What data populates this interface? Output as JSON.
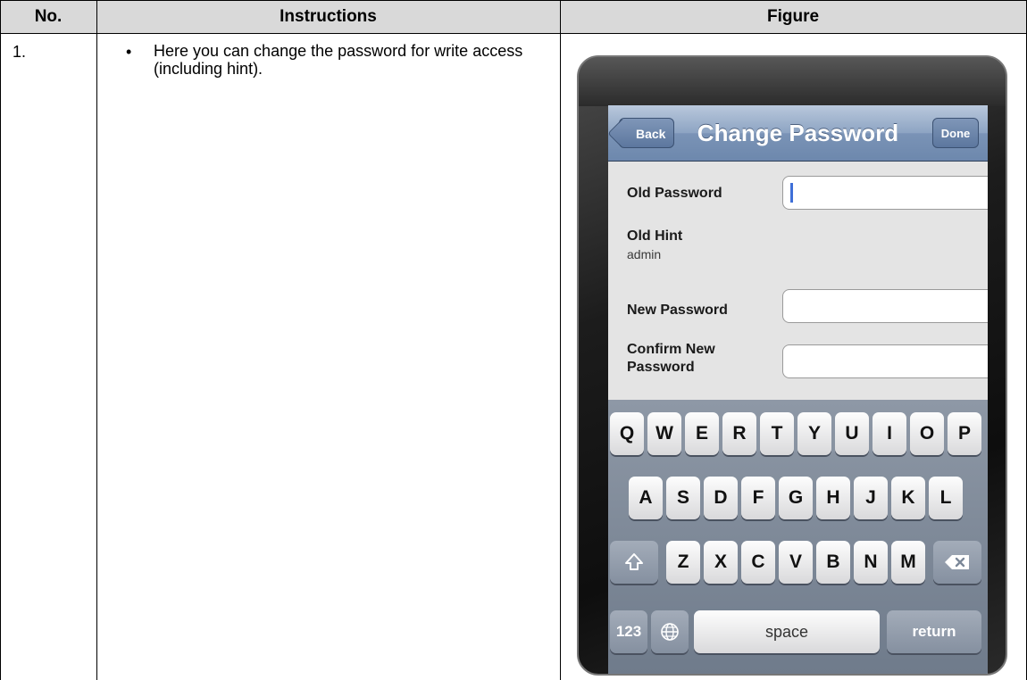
{
  "table": {
    "headers": {
      "no": "No.",
      "instructions": "Instructions",
      "figure": "Figure"
    },
    "row": {
      "number": "1.",
      "bullet": "•",
      "text": "Here you can change the password for write access (including hint)."
    }
  },
  "phone": {
    "nav": {
      "back_label": "Back",
      "title": "Change Password",
      "done_label": "Done"
    },
    "form": {
      "old_password_label": "Old Password",
      "old_hint_label": "Old Hint",
      "old_hint_value": "admin",
      "new_password_label": "New Password",
      "confirm_label_line1": "Confirm New",
      "confirm_label_line2": "Password"
    },
    "keyboard": {
      "row1": [
        "Q",
        "W",
        "E",
        "R",
        "T",
        "Y",
        "U",
        "I",
        "O",
        "P"
      ],
      "row2": [
        "A",
        "S",
        "D",
        "F",
        "G",
        "H",
        "J",
        "K",
        "L"
      ],
      "row3": [
        "Z",
        "X",
        "C",
        "V",
        "B",
        "N",
        "M"
      ],
      "numbers_label": "123",
      "space_label": "space",
      "return_label": "return",
      "shift_icon": "shift-icon",
      "backspace_icon": "backspace-icon",
      "globe_icon": "globe-icon"
    }
  }
}
